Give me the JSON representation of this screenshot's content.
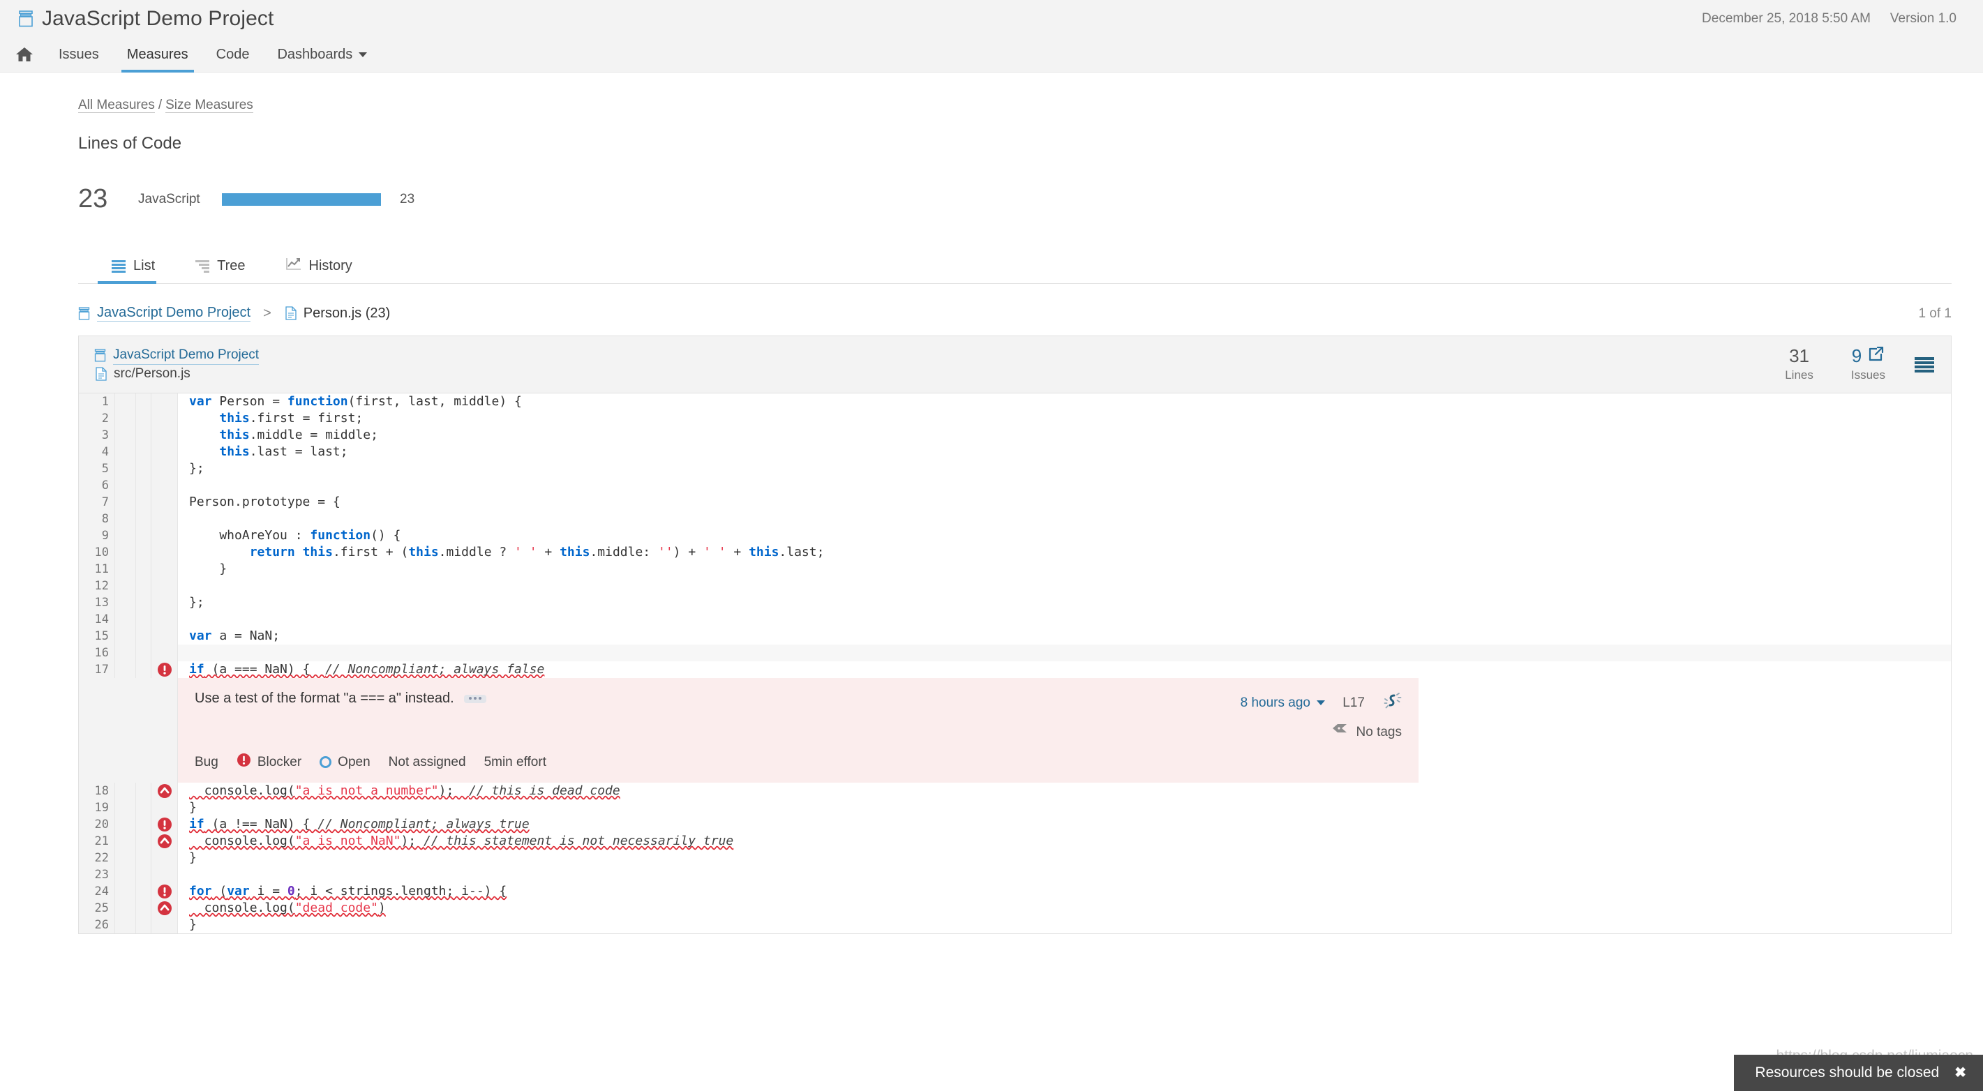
{
  "header": {
    "project_icon": "project-icon",
    "title": "JavaScript Demo Project",
    "date": "December 25, 2018 5:50 AM",
    "version": "Version 1.0"
  },
  "nav": {
    "home_icon": "home-icon",
    "items": [
      {
        "label": "Issues",
        "active": false
      },
      {
        "label": "Measures",
        "active": true
      },
      {
        "label": "Code",
        "active": false
      },
      {
        "label": "Dashboards",
        "active": false,
        "caret": true
      }
    ]
  },
  "breadcrumbs": {
    "all_measures": "All Measures",
    "separator": "/",
    "current": "Size Measures"
  },
  "measure": {
    "title": "Lines of Code",
    "total": "23",
    "language": "JavaScript",
    "bar_value": "23",
    "bar_percent": 100,
    "bar_color": "#4b9fd5"
  },
  "view_tabs": [
    {
      "label": "List",
      "icon": "list-icon",
      "active": true
    },
    {
      "label": "Tree",
      "icon": "tree-icon",
      "active": false
    },
    {
      "label": "History",
      "icon": "history-chart-icon",
      "active": false
    }
  ],
  "file_breadcrumb": {
    "project": "JavaScript Demo Project",
    "separator": ">",
    "file": "Person.js (23)",
    "count": "1 of 1"
  },
  "source_header": {
    "project": "JavaScript Demo Project",
    "path": "src/Person.js",
    "lines_value": "31",
    "lines_label": "Lines",
    "issues_value": "9",
    "issues_label": "Issues",
    "menu_icon": "hamburger-menu-icon"
  },
  "code_lines": [
    {
      "n": "1",
      "marker": null
    },
    {
      "n": "2",
      "marker": null
    },
    {
      "n": "3",
      "marker": null
    },
    {
      "n": "4",
      "marker": null
    },
    {
      "n": "5",
      "marker": null
    },
    {
      "n": "6",
      "marker": null
    },
    {
      "n": "7",
      "marker": null
    },
    {
      "n": "8",
      "marker": null
    },
    {
      "n": "9",
      "marker": null
    },
    {
      "n": "10",
      "marker": null
    },
    {
      "n": "11",
      "marker": null
    },
    {
      "n": "12",
      "marker": null
    },
    {
      "n": "13",
      "marker": null
    },
    {
      "n": "14",
      "marker": null
    },
    {
      "n": "15",
      "marker": null
    },
    {
      "n": "16",
      "marker": null
    },
    {
      "n": "17",
      "marker": "blocker"
    },
    {
      "n": "18",
      "marker": "critical"
    },
    {
      "n": "19",
      "marker": null
    },
    {
      "n": "20",
      "marker": "blocker"
    },
    {
      "n": "21",
      "marker": "critical"
    },
    {
      "n": "22",
      "marker": null
    },
    {
      "n": "23",
      "marker": null
    },
    {
      "n": "24",
      "marker": "blocker"
    },
    {
      "n": "25",
      "marker": "critical"
    },
    {
      "n": "26",
      "marker": null
    }
  ],
  "code_text": {
    "l1": "var Person = function(first, last, middle) {",
    "l2": "    this.first = first;",
    "l3": "    this.middle = middle;",
    "l4": "    this.last = last;",
    "l5": "};",
    "l6": "",
    "l7": "Person.prototype = {",
    "l8": "",
    "l9": "    whoAreYou : function() {",
    "l10": "        return this.first + (this.middle ? ' ' + this.middle: '') + ' ' + this.last;",
    "l11": "    }",
    "l12": "",
    "l13": "};",
    "l14": "",
    "l15": "var a = NaN;",
    "l16": "",
    "l17": "if (a === NaN) {  // Noncompliant; always false",
    "l18": "  console.log(\"a is not a number\");  // this is dead code",
    "l19": "}",
    "l20": "if (a !== NaN) { // Noncompliant; always true",
    "l21": "  console.log(\"a is not NaN\"); // this statement is not necessarily true",
    "l22": "}",
    "l23": "",
    "l24": "for (var i = 0; i < strings.length; i--) {",
    "l25": "  console.log(\"dead code\")",
    "l26": "}"
  },
  "issue": {
    "message": "Use a test of the format \"a === a\" instead.",
    "more_actions": "more-actions",
    "type": "Bug",
    "severity": "Blocker",
    "status": "Open",
    "assignee": "Not assigned",
    "effort": "5min effort",
    "when": "8 hours ago",
    "line_ref": "L17",
    "rule_icon": "sonarqube-rule-icon",
    "tags": "No tags",
    "background": "#fbeded"
  },
  "tooltip": {
    "text": "Resources should be closed",
    "close": "✖",
    "watermark": "https://blog.csdn.net/liumiaocn"
  }
}
